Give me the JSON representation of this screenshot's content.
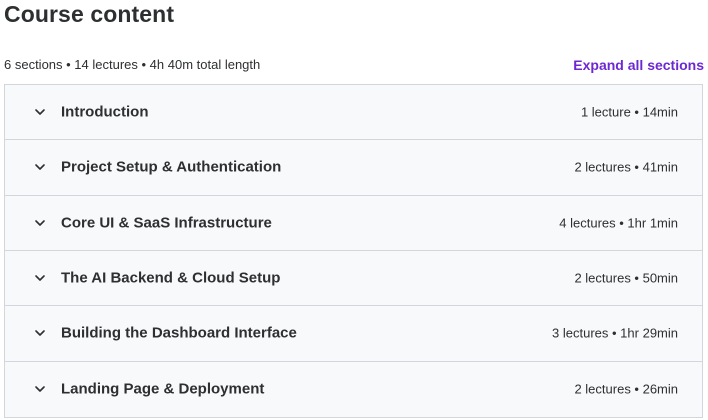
{
  "header": {
    "title": "Course content",
    "summary": "6 sections • 14 lectures • 4h 40m total length",
    "expand_label": "Expand all sections"
  },
  "colors": {
    "accent": "#6d28d2",
    "section_bg": "#f7f9fa",
    "border": "#d1d7dc",
    "text": "#2d2f31"
  },
  "sections": [
    {
      "title": "Introduction",
      "meta": "1 lecture • 14min",
      "icon": "chevron-down-icon"
    },
    {
      "title": "Project Setup & Authentication",
      "meta": "2 lectures • 41min",
      "icon": "chevron-down-icon"
    },
    {
      "title": "Core UI & SaaS Infrastructure",
      "meta": "4 lectures • 1hr 1min",
      "icon": "chevron-down-icon"
    },
    {
      "title": "The AI Backend & Cloud Setup",
      "meta": "2 lectures • 50min",
      "icon": "chevron-down-icon"
    },
    {
      "title": "Building the Dashboard Interface",
      "meta": "3 lectures • 1hr 29min",
      "icon": "chevron-down-icon"
    },
    {
      "title": "Landing Page & Deployment",
      "meta": "2 lectures • 26min",
      "icon": "chevron-down-icon"
    }
  ]
}
